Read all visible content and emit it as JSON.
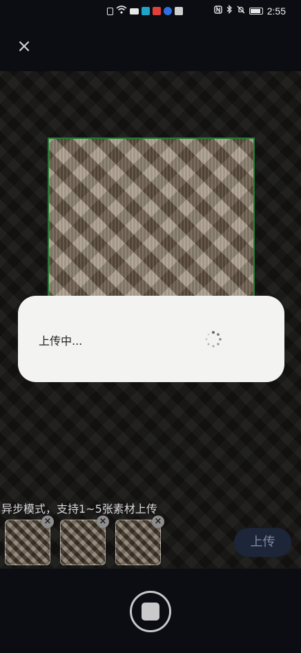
{
  "status_bar": {
    "time": "2:55",
    "left_icons": [
      "alert-icon",
      "wifi-icon",
      "video-icon",
      "app-icon-teal",
      "app-icon-red",
      "app-icon-blue",
      "app-icon-grey"
    ],
    "right_icons": [
      "nfc-icon",
      "bluetooth-icon",
      "mute-icon",
      "battery-icon"
    ]
  },
  "header": {
    "close_label": "×"
  },
  "upload_modal": {
    "text": "上传中..."
  },
  "bottom": {
    "tip": "异步模式，支持1~5张素材上传",
    "upload_label": "上传",
    "thumbnails": [
      {
        "remove_label": "×"
      },
      {
        "remove_label": "×"
      },
      {
        "remove_label": "×"
      }
    ]
  },
  "colors": {
    "focus_frame": "#1e7d32",
    "modal_bg": "#f3f3f1",
    "upload_button_bg": "#1d2538"
  }
}
